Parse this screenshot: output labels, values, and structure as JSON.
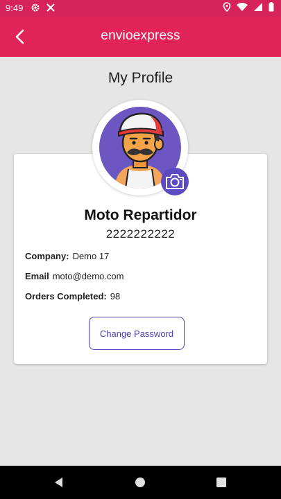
{
  "status_bar": {
    "time": "9:49",
    "icons_left": [
      "gear-icon",
      "tools-icon"
    ],
    "icons_right": [
      "location-icon",
      "wifi-icon",
      "signal-icon",
      "battery-icon"
    ]
  },
  "app_bar": {
    "brand": "envioexpress",
    "back_icon": "chevron-left-icon",
    "color": "#e0245a"
  },
  "page": {
    "title": "My Profile"
  },
  "profile": {
    "name": "Moto Repartidor",
    "phone": "2222222222",
    "avatar_icon": "courier-avatar",
    "camera_icon": "camera-icon",
    "fields": [
      {
        "label": "Company:",
        "value": "Demo 17"
      },
      {
        "label": "Email",
        "value": "moto@demo.com"
      },
      {
        "label": "Orders Completed:",
        "value": "98"
      }
    ]
  },
  "actions": {
    "change_password": "Change Password"
  },
  "nav_bar": {
    "buttons": [
      "back-triangle-icon",
      "home-circle-icon",
      "recents-square-icon"
    ]
  },
  "colors": {
    "accent": "#e0245a",
    "primary_purple": "#4a3fb5",
    "avatar_bg": "#6b56c2"
  }
}
